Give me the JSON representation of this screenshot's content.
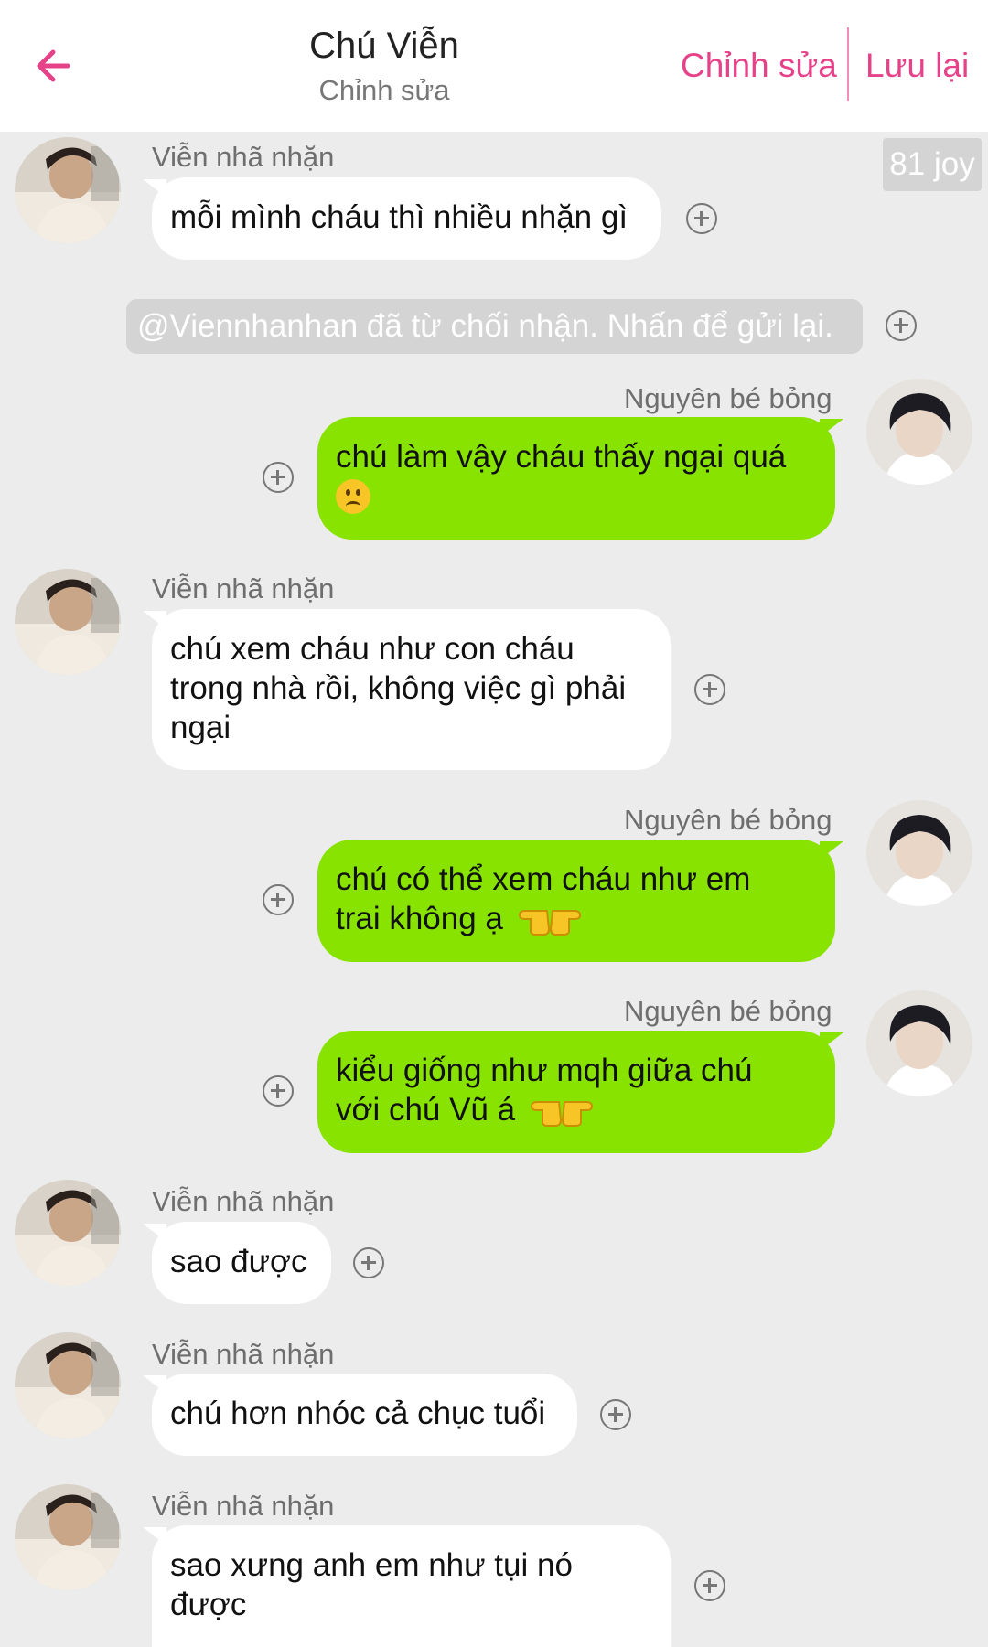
{
  "header": {
    "back_icon": "arrow-left-icon",
    "title": "Chú Viễn",
    "subtitle": "Chỉnh sửa",
    "edit_label": "Chỉnh sửa",
    "save_label": "Lưu lại",
    "accent": "#e6428a"
  },
  "joy_badge": "81 joy",
  "system_notice": "@Viennhanhan đã từ chối nhận. Nhấn để gửi lại.",
  "colors": {
    "incoming": "#ffffff",
    "outgoing": "#88e300",
    "background": "#ececec"
  },
  "messages": [
    {
      "sender": "Viễn nhã nhặn",
      "text": "mỗi mình cháu thì nhiều nhặn gì"
    },
    {
      "sender": "Nguyên bé bỏng",
      "text": "chú làm vậy cháu thấy ngại quá",
      "emoji": "slightly-frowning-face"
    },
    {
      "sender": "Viễn nhã nhặn",
      "line1": "chú xem cháu như con cháu",
      "line2": "trong nhà rồi, không việc gì phải",
      "line3": "ngại"
    },
    {
      "sender": "Nguyên bé bỏng",
      "line1": "chú có thể xem cháu như em",
      "line2": "trai không ạ",
      "emoji": "pointing-fingers"
    },
    {
      "sender": "Nguyên bé bỏng",
      "line1": "kiểu giống như mqh giữa chú",
      "line2": "với chú Vũ á",
      "emoji": "pointing-fingers"
    },
    {
      "sender": "Viễn nhã nhặn",
      "text": "sao được"
    },
    {
      "sender": "Viễn nhã nhặn",
      "text": "chú hơn nhóc cả chục tuổi"
    },
    {
      "sender": "Viễn nhã nhặn",
      "line1": "sao xưng anh em như tụi nó",
      "line2": "được"
    }
  ]
}
